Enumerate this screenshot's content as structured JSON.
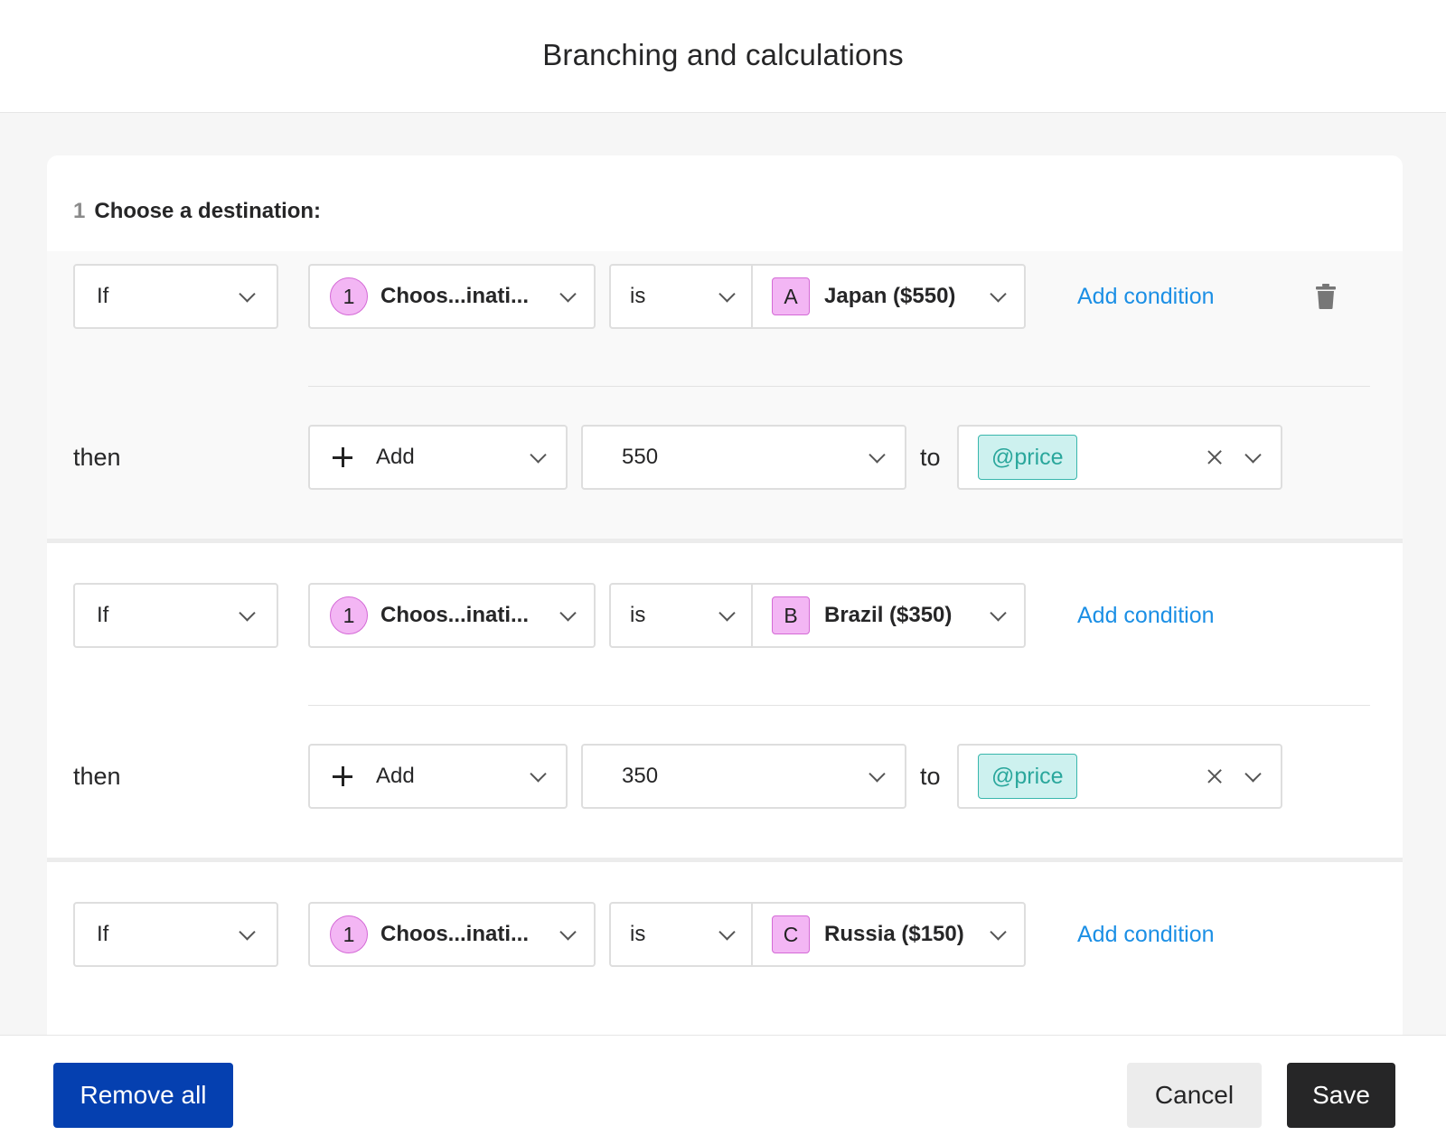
{
  "header": {
    "title": "Branching and calculations"
  },
  "section": {
    "number": "1",
    "label": "Choose a destination:"
  },
  "rules": [
    {
      "if_label": "If",
      "question_number": "1",
      "question_text": "Choos...inati...",
      "operator": "is",
      "choice_letter": "A",
      "choice_text": "Japan ($550)",
      "add_condition": "Add condition",
      "then_label": "then",
      "action": "Add",
      "value": "550",
      "to_label": "to",
      "variable": "@price",
      "deletable": true
    },
    {
      "if_label": "If",
      "question_number": "1",
      "question_text": "Choos...inati...",
      "operator": "is",
      "choice_letter": "B",
      "choice_text": "Brazil ($350)",
      "add_condition": "Add condition",
      "then_label": "then",
      "action": "Add",
      "value": "350",
      "to_label": "to",
      "variable": "@price",
      "deletable": false
    },
    {
      "if_label": "If",
      "question_number": "1",
      "question_text": "Choos...inati...",
      "operator": "is",
      "choice_letter": "C",
      "choice_text": "Russia ($150)",
      "add_condition": "Add condition",
      "deletable": false
    }
  ],
  "footer": {
    "remove_all": "Remove all",
    "cancel": "Cancel",
    "save": "Save"
  },
  "colors": {
    "primary_button": "#0540b0",
    "save_button": "#262627",
    "link": "#1b8fe5",
    "badge": "#f3b6f4",
    "variable_pill": "#cdf1ef"
  },
  "icons": {
    "dropdown": "chevron-down-icon",
    "delete": "trash-icon",
    "add": "plus-icon",
    "clear": "close-icon"
  }
}
